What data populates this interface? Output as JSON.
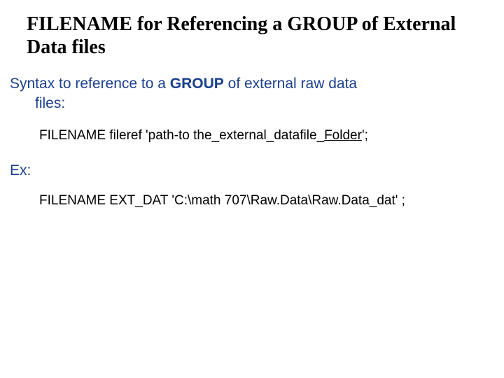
{
  "title": "FILENAME for Referencing a GROUP of External Data files",
  "intro": {
    "pre": "Syntax to reference to a ",
    "bold": "GROUP",
    "post": " of external raw data",
    "line2": "files:"
  },
  "syntax": {
    "pre": "FILENAME fileref 'path-to the_external_datafile_",
    "ul": "Folder",
    "post": "';"
  },
  "ex_label": "Ex:",
  "example": "FILENAME EXT_DAT 'C:\\math 707\\Raw.Data\\Raw.Data_dat' ;"
}
